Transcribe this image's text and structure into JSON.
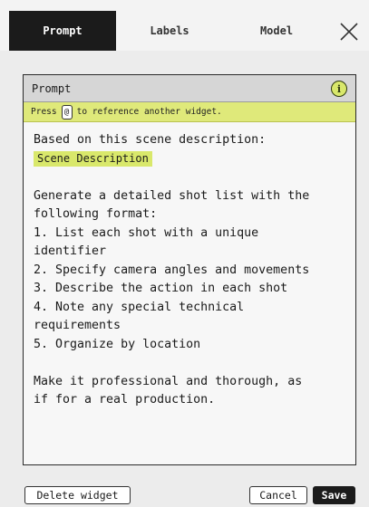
{
  "tabs": {
    "prompt": "Prompt",
    "labels": "Labels",
    "model": "Model",
    "active": "prompt"
  },
  "card": {
    "title": "Prompt",
    "info_icon": "info-icon",
    "info_glyph": "i",
    "hint": {
      "before": "Press",
      "key": "@",
      "after": "to reference another widget."
    },
    "body": {
      "line_01": "Based on this scene description:",
      "reference_chip": "Scene Description",
      "line_03": "",
      "line_04": "Generate a detailed shot list with the",
      "line_05": "following format:",
      "line_06": "1. List each shot with a unique",
      "line_07": "identifier",
      "line_08": "2. Specify camera angles and movements",
      "line_09": "3. Describe the action in each shot",
      "line_10": "4. Note any special technical",
      "line_11": "requirements",
      "line_12": "5. Organize by location",
      "line_13": "",
      "line_14": "Make it professional and thorough, as",
      "line_15": "if for a real production."
    }
  },
  "footer": {
    "delete_label": "Delete widget",
    "cancel_label": "Cancel",
    "save_label": "Save"
  },
  "colors": {
    "accent": "#d9e86b",
    "dark": "#1b1b1b",
    "background": "#ececec"
  }
}
